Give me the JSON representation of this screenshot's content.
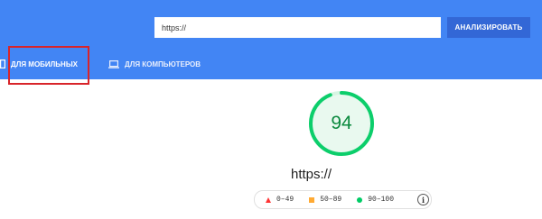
{
  "search": {
    "value": "https://",
    "button_label": "АНАЛИЗИРОВАТЬ"
  },
  "tabs": [
    {
      "label": "ДЛЯ МОБИЛЬНЫХ",
      "icon": "phone-icon",
      "active": true
    },
    {
      "label": "ДЛЯ КОМПЬЮТЕРОВ",
      "icon": "laptop-icon",
      "active": false
    }
  ],
  "score": {
    "value": "94",
    "fraction": 0.94,
    "color": "#0cce6b"
  },
  "page_url": "https://",
  "legend": {
    "items": [
      {
        "label": "0–49",
        "shape": "triangle",
        "color": "#ff3333"
      },
      {
        "label": "50–89",
        "shape": "square",
        "color": "#ffaa33"
      },
      {
        "label": "90–100",
        "shape": "circle",
        "color": "#0cce6b"
      }
    ],
    "info_icon": "info-icon"
  },
  "colors": {
    "header": "#4285f4",
    "button": "#3367d6",
    "highlight": "#d8242a"
  }
}
